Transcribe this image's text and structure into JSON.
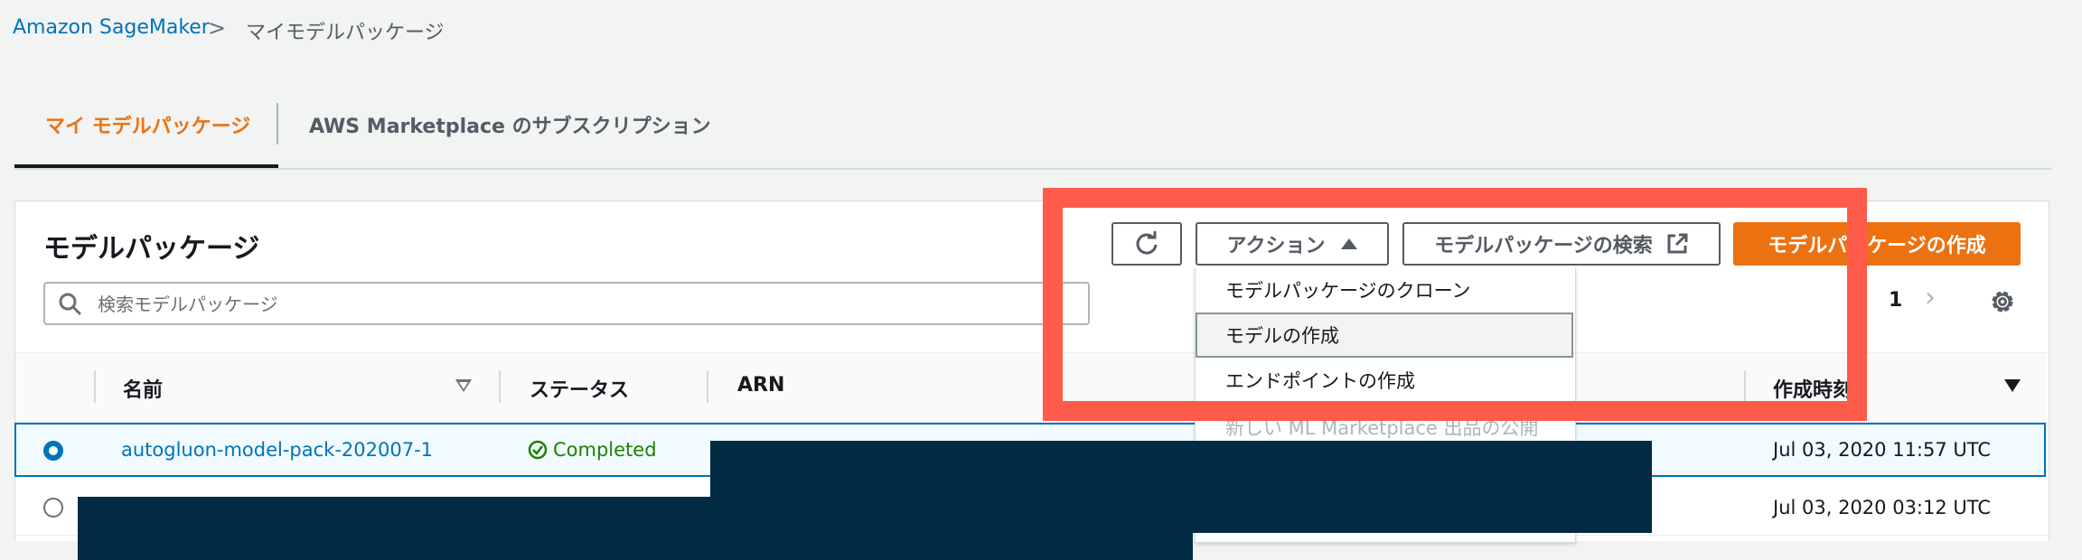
{
  "breadcrumb": {
    "root": "Amazon SageMaker",
    "separator": ">",
    "current": "マイモデルパッケージ"
  },
  "tabs": [
    {
      "label": "マイ モデルパッケージ",
      "active": true
    },
    {
      "label": "AWS Marketplace のサブスクリプション",
      "active": false
    }
  ],
  "panel": {
    "title": "モデルパッケージ"
  },
  "search": {
    "placeholder": "検索モデルパッケージ",
    "value": ""
  },
  "toolbar": {
    "actions_label": "アクション",
    "search_packages_label": "モデルパッケージの検索",
    "create_label": "モデルパッケージの作成"
  },
  "pagination": {
    "current_page": "1"
  },
  "table": {
    "columns": [
      "名前",
      "ステータス",
      "ARN",
      "作成時刻"
    ],
    "rows": [
      {
        "name": "autogluon-model-pack-202007-1",
        "status": "Completed",
        "created": "Jul 03, 2020 11:57 UTC",
        "selected": true
      },
      {
        "name": "",
        "status": "",
        "created": "Jul 03, 2020 03:12 UTC",
        "selected": false
      }
    ]
  },
  "actions_menu": {
    "items": [
      {
        "label": "モデルパッケージのクローン",
        "state": "normal"
      },
      {
        "label": "モデルの作成",
        "state": "highlighted"
      },
      {
        "label": "エンドポイントの作成",
        "state": "normal"
      },
      {
        "label": "新しい ML Marketplace 出品の公開",
        "state": "disabled"
      }
    ]
  },
  "colors": {
    "accent": "#ec7211",
    "link": "#0073bb",
    "success": "#1d8102",
    "annotation": "#ff5b4a",
    "redaction": "#012a43"
  },
  "icons": [
    "refresh-icon",
    "caret-up-icon",
    "external-link-icon",
    "search-icon",
    "chevron-right-icon",
    "gear-icon",
    "sort-icon",
    "check-circle-icon"
  ]
}
